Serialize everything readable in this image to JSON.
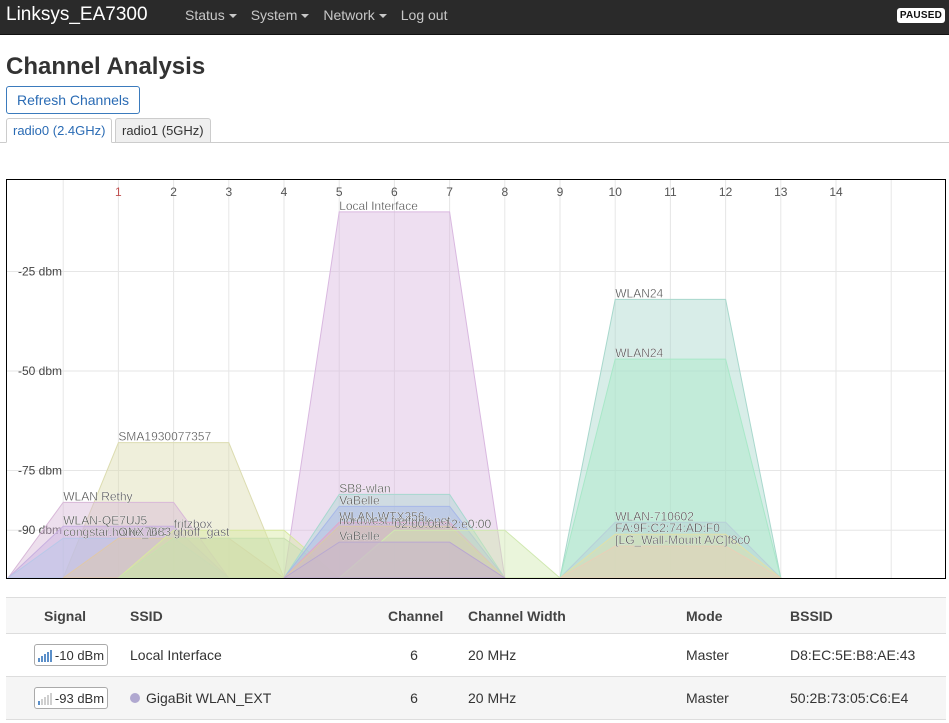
{
  "topbar": {
    "brand": "Linksys_EA7300",
    "nav": [
      {
        "label": "Status",
        "dropdown": true
      },
      {
        "label": "System",
        "dropdown": true
      },
      {
        "label": "Network",
        "dropdown": true
      },
      {
        "label": "Log out",
        "dropdown": false
      }
    ],
    "paused_badge": "PAUSED"
  },
  "page": {
    "title": "Channel Analysis",
    "refresh_button": "Refresh Channels",
    "tabs": [
      {
        "label": "radio0 (2.4GHz)",
        "active": true
      },
      {
        "label": "radio1 (5GHz)",
        "active": false
      }
    ]
  },
  "chart_data": {
    "type": "area",
    "x_ticks": [
      "1",
      "2",
      "3",
      "4",
      "5",
      "6",
      "7",
      "8",
      "9",
      "10",
      "11",
      "12",
      "13",
      "14"
    ],
    "y_ticks": [
      {
        "label": "-25 dbm",
        "value": -25
      },
      {
        "label": "-50 dbm",
        "value": -50
      },
      {
        "label": "-75 dbm",
        "value": -75
      },
      {
        "label": "-90 dbm",
        "value": -90
      }
    ],
    "ylim": [
      -102,
      -2
    ],
    "grid": true,
    "networks": [
      {
        "ssid": "Local Interface",
        "channel": 6,
        "signal_dbm": -10,
        "color": "#d9b8e0",
        "label": true
      },
      {
        "ssid": "WLAN24",
        "channel": 11,
        "signal_dbm": -32,
        "color": "#a8d8cc",
        "label": true
      },
      {
        "ssid": "WLAN24",
        "channel": 11,
        "signal_dbm": -47,
        "color": "#a8e8c8",
        "label": true
      },
      {
        "ssid": "SMA1930077357",
        "channel": 2,
        "signal_dbm": -68,
        "color": "#dcdcb0",
        "label": true
      },
      {
        "ssid": "WLAN Rethy",
        "channel": 1,
        "signal_dbm": -83,
        "color": "#d8b8d8",
        "label": true
      },
      {
        "ssid": "WLAN-QE7UJ5",
        "channel": 1,
        "signal_dbm": -89,
        "color": "#c8b0e0",
        "label": true
      },
      {
        "ssid": "congstar.home_DC",
        "channel": 1,
        "signal_dbm": -92,
        "color": "#b8c8e8",
        "label": true
      },
      {
        "ssid": "ONX7683",
        "channel": 2,
        "signal_dbm": -92,
        "color": "#e0c8a8",
        "label": true
      },
      {
        "ssid": "fritzbox",
        "channel": 3,
        "signal_dbm": -90,
        "color": "#d8e8a0",
        "label": true
      },
      {
        "ssid": "ghoff_gast",
        "channel": 3,
        "signal_dbm": -92,
        "color": "#c8e0b0",
        "label": true
      },
      {
        "ssid": "SB8-wlan",
        "channel": 6,
        "signal_dbm": -81,
        "color": "#a8d8d0",
        "label": true
      },
      {
        "ssid": "VaBelle",
        "channel": 6,
        "signal_dbm": -84,
        "color": "#a8b8e8",
        "label": true
      },
      {
        "ssid": "WLAN-WTX256",
        "channel": 6,
        "signal_dbm": -88,
        "color": "#e0a8c8",
        "label": true
      },
      {
        "ssid": "nordwest.freifunk.net",
        "channel": 6,
        "signal_dbm": -89,
        "color": "#d8c8a8",
        "label": true
      },
      {
        "ssid": "02:00:0a:12:e0:00",
        "channel": 7,
        "signal_dbm": -90,
        "color": "#d0e8b0",
        "label": true
      },
      {
        "ssid": "VaBelle",
        "channel": 6,
        "signal_dbm": -93,
        "color": "#e8d8c0",
        "label": true
      },
      {
        "ssid": "WLAN-710602",
        "channel": 11,
        "signal_dbm": -88,
        "color": "#b8d0d8",
        "label": true
      },
      {
        "ssid": "FA:9F:C2:74:AD:F0",
        "channel": 11,
        "signal_dbm": -91,
        "color": "#e0e0a8",
        "label": true
      },
      {
        "ssid": "[LG_Wall-Mount A/C]f8c0",
        "channel": 11,
        "signal_dbm": -94,
        "color": "#e8d0b8",
        "label": true
      },
      {
        "ssid": "GigaBit WLAN_EXT",
        "channel": 6,
        "signal_dbm": -93,
        "color": "#b8a8d0",
        "label": false
      }
    ]
  },
  "table": {
    "headers": [
      "Signal",
      "SSID",
      "Channel",
      "Channel Width",
      "Mode",
      "BSSID"
    ],
    "rows": [
      {
        "signal": "-10 dBm",
        "level": 5,
        "ssid": "Local Interface",
        "dot_color": "",
        "channel": "6",
        "width": "20 MHz",
        "mode": "Master",
        "bssid": "D8:EC:5E:B8:AE:43"
      },
      {
        "signal": "-93 dBm",
        "level": 1,
        "ssid": "GigaBit WLAN_EXT",
        "dot_color": "#b0a8d0",
        "channel": "6",
        "width": "20 MHz",
        "mode": "Master",
        "bssid": "50:2B:73:05:C6:E4"
      }
    ]
  }
}
